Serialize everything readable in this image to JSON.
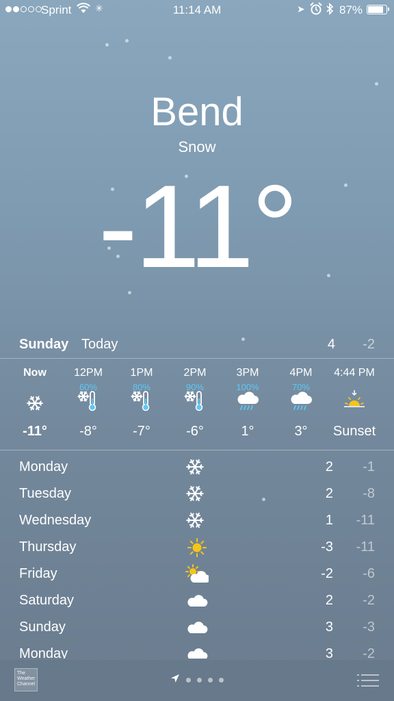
{
  "status_bar": {
    "carrier": "Sprint",
    "time": "11:14 AM",
    "battery": "87%",
    "battery_level": 0.87,
    "signal_bars": 2,
    "icons": [
      "signal-dots-icon",
      "wifi-icon",
      "activity-spinner-icon",
      "location-arrow-icon",
      "alarm-clock-icon",
      "bluetooth-icon",
      "battery-icon"
    ]
  },
  "header": {
    "city": "Bend",
    "condition": "Snow",
    "temperature": "-11°"
  },
  "today": {
    "day": "Sunday",
    "label": "Today",
    "high": "4",
    "low": "-2"
  },
  "hourly": [
    {
      "time": "Now",
      "precip": "",
      "icon": "snowflake-icon",
      "temp": "-11°"
    },
    {
      "time": "12PM",
      "precip": "60%",
      "icon": "snow-thermometer-icon",
      "temp": "-8°"
    },
    {
      "time": "1PM",
      "precip": "80%",
      "icon": "snow-thermometer-icon",
      "temp": "-7°"
    },
    {
      "time": "2PM",
      "precip": "90%",
      "icon": "snow-thermometer-icon",
      "temp": "-6°"
    },
    {
      "time": "3PM",
      "precip": "100%",
      "icon": "rain-cloud-icon",
      "temp": "1°"
    },
    {
      "time": "4PM",
      "precip": "70%",
      "icon": "rain-cloud-icon",
      "temp": "3°"
    },
    {
      "time": "4:44 PM",
      "precip": "",
      "icon": "sunset-icon",
      "temp": "Sunset"
    }
  ],
  "daily": [
    {
      "day": "Monday",
      "icon": "snowflake-icon",
      "high": "2",
      "low": "-1"
    },
    {
      "day": "Tuesday",
      "icon": "snowflake-icon",
      "high": "2",
      "low": "-8"
    },
    {
      "day": "Wednesday",
      "icon": "snowflake-icon",
      "high": "1",
      "low": "-11"
    },
    {
      "day": "Thursday",
      "icon": "sun-icon",
      "high": "-3",
      "low": "-11"
    },
    {
      "day": "Friday",
      "icon": "partly-cloudy-icon",
      "high": "-2",
      "low": "-6"
    },
    {
      "day": "Saturday",
      "icon": "cloud-icon",
      "high": "2",
      "low": "-2"
    },
    {
      "day": "Sunday",
      "icon": "cloud-icon",
      "high": "3",
      "low": "-3"
    },
    {
      "day": "Monday",
      "icon": "cloud-icon",
      "high": "3",
      "low": "-2"
    }
  ],
  "bottom_bar": {
    "logo_text": "The Weather Channel",
    "pages": 4,
    "icons": [
      "weather-channel-logo-icon",
      "location-arrow-icon",
      "list-icon"
    ]
  },
  "colors": {
    "precip_blue": "#5ec8f5",
    "sun_yellow": "#f5c518",
    "bg_top": "#8aa7bd",
    "bg_bottom": "#6a7c8e"
  }
}
